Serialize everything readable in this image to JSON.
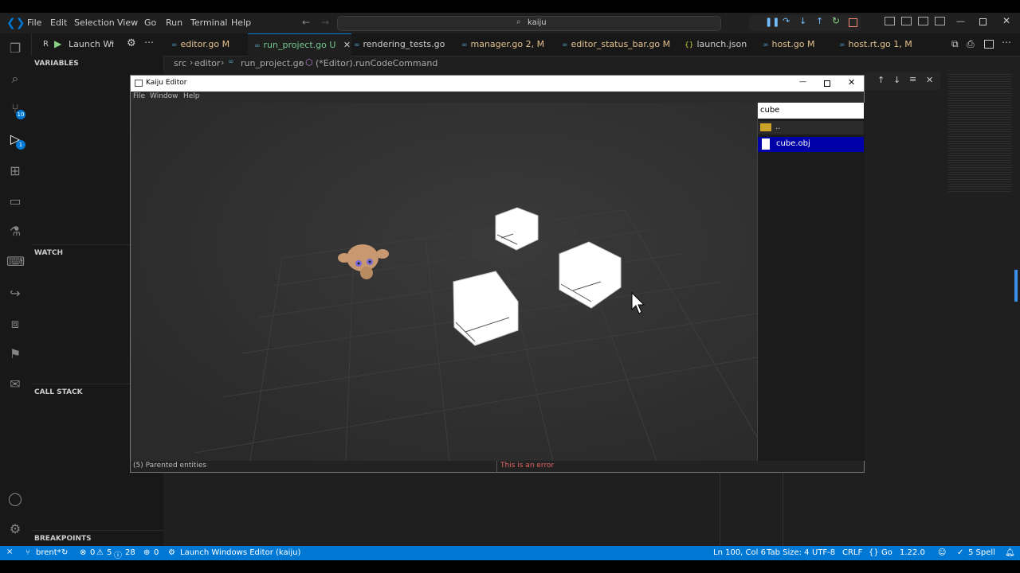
{
  "titlebar": {
    "menus": [
      "File",
      "Edit",
      "Selection",
      "View",
      "Go",
      "Run",
      "Terminal",
      "Help"
    ],
    "search": "kaiju"
  },
  "debug": {
    "config_label": "Launch Wi"
  },
  "tabs": [
    {
      "name": "editor.go",
      "flag": "M"
    },
    {
      "name": "run_project.go",
      "flag": "U"
    },
    {
      "name": "rendering_tests.go",
      "flag": ""
    },
    {
      "name": "manager.go",
      "flag": "2, M"
    },
    {
      "name": "editor_status_bar.go",
      "flag": "M"
    },
    {
      "name": "launch.json",
      "flag": ""
    },
    {
      "name": "host.go",
      "flag": "M"
    },
    {
      "name": "host.rt.go",
      "flag": "1, M"
    }
  ],
  "breadcrumb": [
    "src",
    "editor",
    "run_project.go",
    "(*Editor).runCodeCommand"
  ],
  "activity": {
    "source_control_badge": "10",
    "debug_badge": "1"
  },
  "sidebar": {
    "sections": [
      "VARIABLES",
      "WATCH",
      "CALL STACK",
      "BREAKPOINTS"
    ]
  },
  "kaiju": {
    "title": "Kaiju Editor",
    "menus": [
      "File",
      "Window",
      "Help"
    ],
    "search_value": "cube",
    "files": [
      {
        "name": "..",
        "type": "folder",
        "selected": false
      },
      {
        "name": "cube.obj",
        "type": "file",
        "selected": true
      }
    ],
    "status_left": "(5) Parented entities",
    "status_error": "This is an error"
  },
  "status": {
    "branch": "brent*",
    "errors": "0",
    "warnings": "5",
    "infos": "28",
    "ports": "0",
    "debug_target": "Launch Windows Editor (kaiju)",
    "position": "Ln 100, Col 6",
    "tab_size": "Tab Size: 4",
    "encoding": "UTF-8",
    "eol": "CRLF",
    "language": "Go",
    "go_version": "1.22.0",
    "spell": "5 Spell"
  },
  "colors": {
    "accent": "#0078d4",
    "selection": "#0000a8",
    "error_text": "#e06060",
    "modified": "#e2c08d"
  }
}
